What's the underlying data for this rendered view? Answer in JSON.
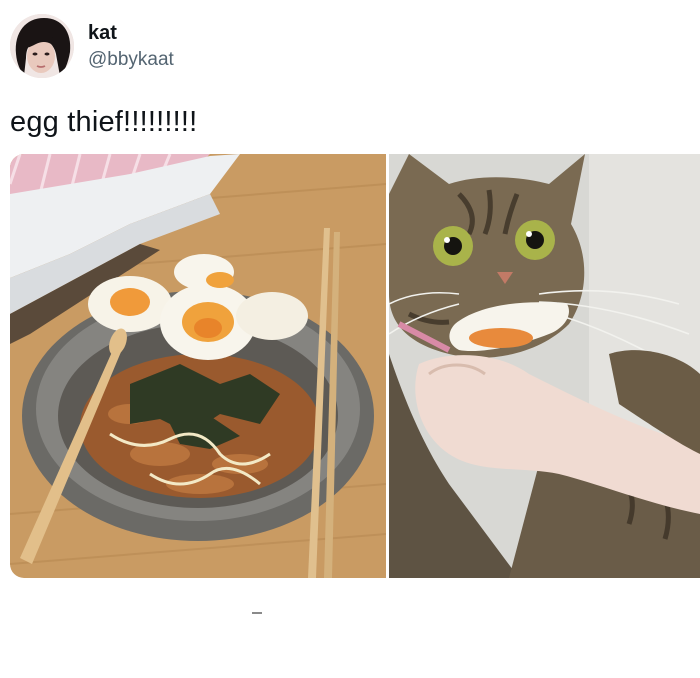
{
  "tweet": {
    "author": {
      "display_name": "kat",
      "handle": "@bbykaat"
    },
    "text": "egg thief!!!!!!!!!",
    "media": [
      {
        "subject": "food-photo"
      },
      {
        "subject": "cat-photo"
      }
    ]
  }
}
